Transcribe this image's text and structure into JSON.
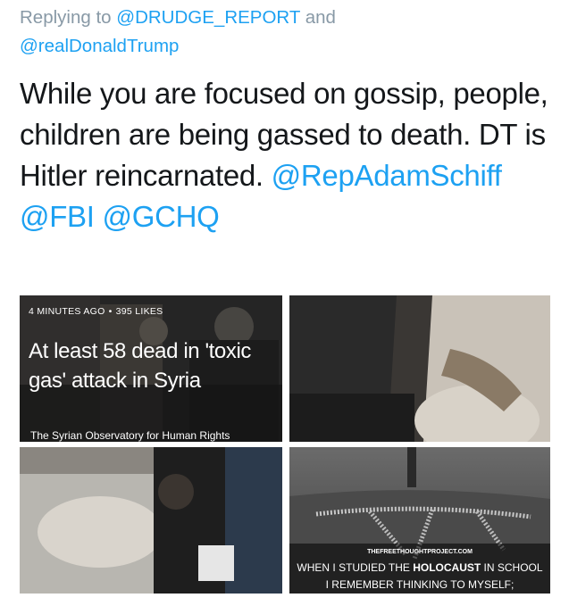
{
  "reply": {
    "prefix": "Replying to ",
    "mention1": "@DRUDGE_REPORT",
    "conjunction": " and",
    "mention2": "@realDonaldTrump"
  },
  "tweet": {
    "text": "While you are focused on gossip, people, children are being gassed to death. DT is Hitler reincarnated.",
    "mention1": "@RepAdamSchiff",
    "mention2": "@FBI",
    "mention3": "@GCHQ"
  },
  "media": {
    "tile1": {
      "time": "4 MINUTES AGO",
      "separator": "•",
      "likes": "395 LIKES",
      "headline": "At least 58 dead in 'toxic gas' attack in Syria",
      "source": "The Syrian Observatory for Human Rights"
    },
    "tile4": {
      "watermark": "THEFREETHOUGHTPROJECT.COM",
      "line1_pre": "WHEN I STUDIED THE ",
      "line1_bold": "HOLOCAUST",
      "line1_post": " IN SCHOOL",
      "line2": "I REMEMBER THINKING TO MYSELF;"
    }
  },
  "colors": {
    "link": "#1da1f2",
    "meta": "#8899a6",
    "text": "#14171a"
  }
}
